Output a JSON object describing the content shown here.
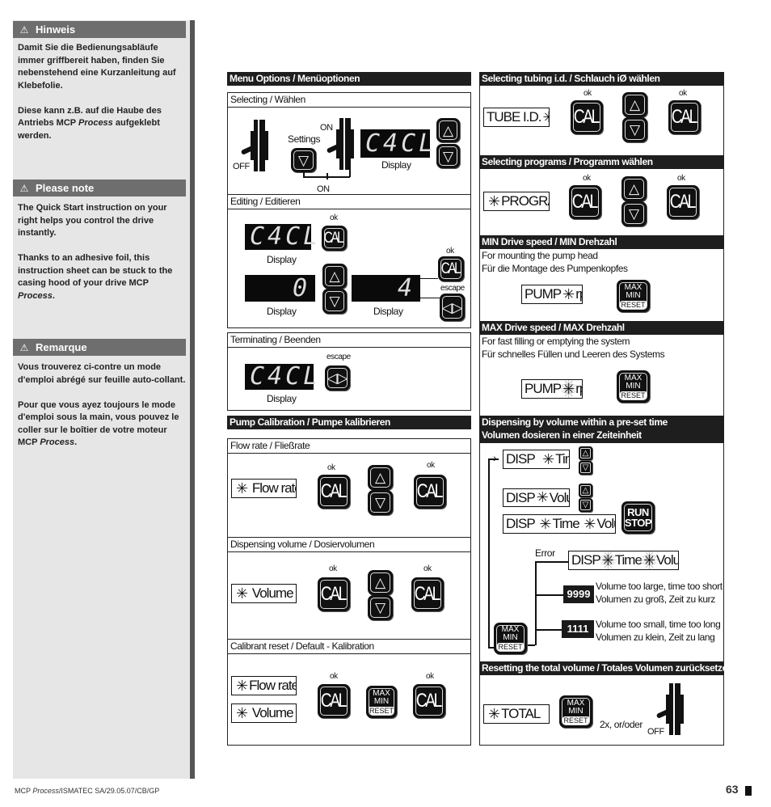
{
  "sidebar": {
    "sections": [
      {
        "title": "Hinweis",
        "icon": "warning-icon",
        "paragraphs": [
          {
            "pre": "Damit Sie die Bedienungsabläufe immer griffbereit haben, finden Sie nebenstehend eine Kurzanleitung auf Klebefolie."
          },
          {
            "pre": "Diese kann z.B. auf die Haube des Antriebs MCP ",
            "em": "Process",
            "post": " aufgeklebt werden."
          }
        ]
      },
      {
        "title": "Please note",
        "icon": "warning-icon",
        "paragraphs": [
          {
            "pre": "The Quick Start instruction on your right helps you control the drive instantly."
          },
          {
            "pre": "Thanks to an adhesive foil, this instruction sheet can be stuck to the casing hood of your drive MCP ",
            "em": "Process",
            "post": "."
          }
        ]
      },
      {
        "title": "Remarque",
        "icon": "warning-icon",
        "paragraphs": [
          {
            "pre": "Vous trouverez ci-contre un mode d'emploi abrégé sur feuille auto-collant."
          },
          {
            "pre": "Pour que vous ayez toujours le mode d'emploi sous la main, vous pouvez le coller sur le boîtier de votre moteur MCP ",
            "em": "Process",
            "post": "."
          }
        ]
      }
    ]
  },
  "keys": {
    "cal": "CAL",
    "max": "MAX",
    "min": "MIN",
    "reset": "RESET",
    "run": "RUN",
    "stop": "STOP"
  },
  "menu": {
    "header": "Menu Options / Menüoptionen",
    "selecting": {
      "title": "Selecting  /  Wählen",
      "off": "OFF",
      "on": "ON",
      "settings": "Settings",
      "display": "Display",
      "lcd": "C4CL"
    },
    "editing": {
      "title": "Editing / Editieren",
      "lcd1": "C4CL",
      "lcd2": "0",
      "lcd3": "4",
      "display": "Display",
      "ok": "ok",
      "escape": "escape"
    },
    "terminating": {
      "title": "Terminating / Beenden",
      "lcd": "C4CL",
      "display": "Display",
      "escape": "escape"
    }
  },
  "calibration": {
    "header": "Pump Calibration / Pumpe kalibrieren",
    "ok": "ok",
    "flow": {
      "title": "Flow rate / Fließrate",
      "label": "Flow rate"
    },
    "volume": {
      "title": "Dispensing volume / Dosiervolumen",
      "label": "Volume"
    },
    "reset": {
      "title": "Calibrant reset / Default - Kalibration",
      "flow": "Flow rate",
      "volume": "Volume"
    }
  },
  "tubing": {
    "header": "Selecting tubing i.d.  /  Schlauch iØ wählen",
    "label": "TUBE I.D.",
    "ok": "ok"
  },
  "programs": {
    "header": "Selecting programs  /  Programm wählen",
    "label": "PROGRAM",
    "ok": "ok"
  },
  "min_speed": {
    "header": "MIN Drive speed  /  MIN Drehzahl",
    "line1": "For mounting the pump head",
    "line2": "Für die Montage des Pumpenkopfes",
    "pump": "PUMP",
    "rpm": "rpm"
  },
  "max_speed": {
    "header": "MAX Drive speed  /  MAX Drehzahl",
    "line1": "For fast filling or emptying the system",
    "line2": "Für schnelles Füllen und Leeren des Systems",
    "pump": "PUMP",
    "rpm": "rpm"
  },
  "dispensing": {
    "header1": "Dispensing by volume within a pre-set time",
    "header2": "Volumen dosieren in einer Zeiteinheit",
    "disp": "DISP",
    "time": "Time",
    "volume": "Volume",
    "error": "Error",
    "code_high": "9999",
    "high_en": "Volume too large, time too short",
    "high_de": "Volumen zu groß, Zeit zu kurz",
    "code_low": "1111",
    "low_en": "Volume too small, time too long",
    "low_de": "Volumen zu klein, Zeit zu lang"
  },
  "total": {
    "header": "Resetting the total volume  /  Totales Volumen zurücksetzen",
    "label": "TOTAL",
    "times": "2x, or/oder",
    "off": "OFF"
  },
  "footer": {
    "doc_pre": "MCP ",
    "doc_em": "Process",
    "doc_post": "/ISMATEC SA/29.05.07/CB/GP",
    "page": "63"
  }
}
